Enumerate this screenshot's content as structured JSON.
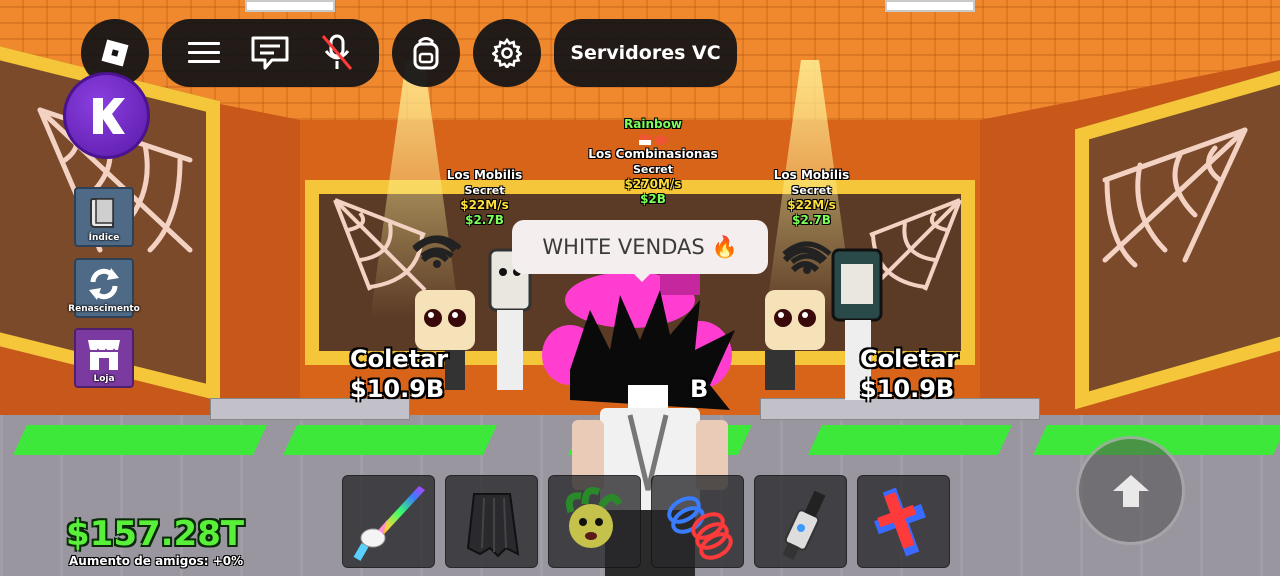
{
  "topbar": {
    "roblox_menu_icon": "roblox-logo-icon",
    "menu_icon": "hamburger-icon",
    "chat_icon": "chat-icon",
    "mic_icon": "mic-muted-icon",
    "backpack_icon": "backpack-icon",
    "settings_icon": "gear-icon",
    "server_label": "Servidores VC"
  },
  "side_menu": [
    {
      "label": "Índice",
      "icon": "book-icon",
      "color": "#4f6a86"
    },
    {
      "label": "Renascimento",
      "icon": "rebirth-icon",
      "color": "#4f6a86"
    },
    {
      "label": "Loja",
      "icon": "shop-icon",
      "color": "#7a3aa0"
    }
  ],
  "kick_button_icon": "k-logo-icon",
  "billboards": [
    {
      "name": "Los Mobilis",
      "rarity": "Secret",
      "rate": "$22M/s",
      "price": "$2.7B"
    },
    {
      "mutation": "Rainbow",
      "name": "Los Combinasionas",
      "rarity": "Secret",
      "rate": "$270M/s",
      "price": "$2B"
    },
    {
      "name": "Los Mobilis",
      "rarity": "Secret",
      "rate": "$22M/s",
      "price": "$2.7B"
    }
  ],
  "collect_left": {
    "label": "Coletar",
    "amount": "$10.9B"
  },
  "collect_right": {
    "label": "Coletar",
    "amount": "$10.9B"
  },
  "partial_text": "B",
  "chat_bubble": {
    "text": "WHITE VENDAS",
    "emoji": "🔥"
  },
  "player": {
    "money": "$157.28T",
    "friend_bonus": "Aumento de amigos: +0%"
  },
  "hotbar": [
    {
      "icon": "unicorn-sword-icon"
    },
    {
      "icon": "cape-icon"
    },
    {
      "icon": "medusa-head-icon"
    },
    {
      "icon": "coil-spring-icon"
    },
    {
      "icon": "grapple-gun-icon"
    },
    {
      "icon": "cross-tool-icon"
    }
  ],
  "jump_icon": "up-arrow-icon",
  "colors": {
    "money_green": "#58f038",
    "pad_green": "#3ee83b",
    "wall_orange": "#d8641a",
    "frame_yellow": "#f5c63a",
    "ui_dark": "#141416",
    "brainrot_pink": "#ff3ed1"
  }
}
